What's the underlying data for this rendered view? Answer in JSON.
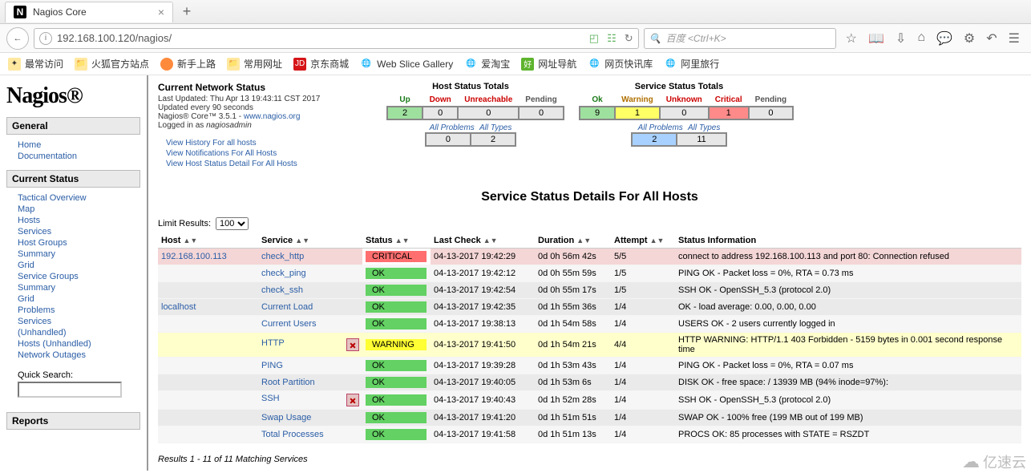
{
  "chrome": {
    "tab_title": "Nagios Core",
    "plus_title": "+",
    "url": "192.168.100.120/nagios/",
    "search_placeholder": "百度 <Ctrl+K>",
    "bookmarks": [
      "最常访问",
      "火狐官方站点",
      "新手上路",
      "常用网址",
      "京东商城",
      "Web Slice Gallery",
      "爱淘宝",
      "网址导航",
      "网页快讯库",
      "阿里旅行"
    ]
  },
  "logo": "Nagios®",
  "nav": {
    "general": {
      "title": "General",
      "items": [
        "Home",
        "Documentation"
      ]
    },
    "current_status": {
      "title": "Current Status",
      "items": [
        "Tactical Overview",
        "Map",
        "Hosts",
        "Services",
        "Host Groups"
      ],
      "hg_sub": [
        "Summary",
        "Grid"
      ],
      "sg_title": "Service Groups",
      "sg_sub": [
        "Summary",
        "Grid"
      ],
      "problems": "Problems",
      "prob_sub": [
        "Services",
        "(Unhandled)",
        "Hosts (Unhandled)",
        "Network Outages"
      ]
    },
    "quick_search": "Quick Search:",
    "reports": {
      "title": "Reports"
    }
  },
  "status_block": {
    "title": "Current Network Status",
    "updated": "Last Updated: Thu Apr 13 19:43:11 CST 2017",
    "every": "Updated every 90 seconds",
    "product": "Nagios® Core™ 3.5.1 - ",
    "product_link": "www.nagios.org",
    "logged": "Logged in as ",
    "user": "nagiosadmin"
  },
  "links": [
    "View History For all hosts",
    "View Notifications For All Hosts",
    "View Host Status Detail For All Hosts"
  ],
  "host_totals": {
    "title": "Host Status Totals",
    "headers": [
      "Up",
      "Down",
      "Unreachable",
      "Pending"
    ],
    "values": [
      "2",
      "0",
      "0",
      "0"
    ],
    "sub_headers": [
      "All Problems",
      "All Types"
    ],
    "sub_values": [
      "0",
      "2"
    ]
  },
  "svc_totals": {
    "title": "Service Status Totals",
    "headers": [
      "Ok",
      "Warning",
      "Unknown",
      "Critical",
      "Pending"
    ],
    "values": [
      "9",
      "1",
      "0",
      "1",
      "0"
    ],
    "sub_headers": [
      "All Problems",
      "All Types"
    ],
    "sub_values": [
      "2",
      "11"
    ]
  },
  "page_title": "Service Status Details For All Hosts",
  "limit": {
    "label": "Limit Results:",
    "value": "100"
  },
  "columns": [
    "Host",
    "Service",
    "Status",
    "Last Check",
    "Duration",
    "Attempt",
    "Status Information"
  ],
  "rows": [
    {
      "host": "192.168.100.113",
      "svc": "check_http",
      "status": "CRITICAL",
      "lc": "04-13-2017 19:42:29",
      "dur": "0d 0h 56m 42s",
      "att": "5/5",
      "info": "connect to address 192.168.100.113 and port 80: Connection refused",
      "cls": "crit"
    },
    {
      "host": "",
      "svc": "check_ping",
      "status": "OK",
      "lc": "04-13-2017 19:42:12",
      "dur": "0d 0h 55m 59s",
      "att": "1/5",
      "info": "PING OK - Packet loss = 0%, RTA = 0.73 ms",
      "cls": "even"
    },
    {
      "host": "",
      "svc": "check_ssh",
      "status": "OK",
      "lc": "04-13-2017 19:42:54",
      "dur": "0d 0h 55m 17s",
      "att": "1/5",
      "info": "SSH OK - OpenSSH_5.3 (protocol 2.0)",
      "cls": "odd"
    },
    {
      "host": "localhost",
      "svc": "Current Load",
      "status": "OK",
      "lc": "04-13-2017 19:42:35",
      "dur": "0d 1h 55m 36s",
      "att": "1/4",
      "info": "OK - load average: 0.00, 0.00, 0.00",
      "cls": "odd"
    },
    {
      "host": "",
      "svc": "Current Users",
      "status": "OK",
      "lc": "04-13-2017 19:38:13",
      "dur": "0d 1h 54m 58s",
      "att": "1/4",
      "info": "USERS OK - 2 users currently logged in",
      "cls": "even"
    },
    {
      "host": "",
      "svc": "HTTP",
      "status": "WARNING",
      "lc": "04-13-2017 19:41:50",
      "dur": "0d 1h 54m 21s",
      "att": "4/4",
      "info": "HTTP WARNING: HTTP/1.1 403 Forbidden - 5159 bytes in 0.001 second response time",
      "cls": "warn",
      "icon": true
    },
    {
      "host": "",
      "svc": "PING",
      "status": "OK",
      "lc": "04-13-2017 19:39:28",
      "dur": "0d 1h 53m 43s",
      "att": "1/4",
      "info": "PING OK - Packet loss = 0%, RTA = 0.07 ms",
      "cls": "even"
    },
    {
      "host": "",
      "svc": "Root Partition",
      "status": "OK",
      "lc": "04-13-2017 19:40:05",
      "dur": "0d 1h 53m 6s",
      "att": "1/4",
      "info": "DISK OK - free space: / 13939 MB (94% inode=97%):",
      "cls": "odd"
    },
    {
      "host": "",
      "svc": "SSH",
      "status": "OK",
      "lc": "04-13-2017 19:40:43",
      "dur": "0d 1h 52m 28s",
      "att": "1/4",
      "info": "SSH OK - OpenSSH_5.3 (protocol 2.0)",
      "cls": "even",
      "icon": true
    },
    {
      "host": "",
      "svc": "Swap Usage",
      "status": "OK",
      "lc": "04-13-2017 19:41:20",
      "dur": "0d 1h 51m 51s",
      "att": "1/4",
      "info": "SWAP OK - 100% free (199 MB out of 199 MB)",
      "cls": "odd"
    },
    {
      "host": "",
      "svc": "Total Processes",
      "status": "OK",
      "lc": "04-13-2017 19:41:58",
      "dur": "0d 1h 51m 13s",
      "att": "1/4",
      "info": "PROCS OK: 85 processes with STATE = RSZDT",
      "cls": "even"
    }
  ],
  "results_line": "Results 1 - 11 of 11 Matching Services",
  "watermark": "亿速云"
}
